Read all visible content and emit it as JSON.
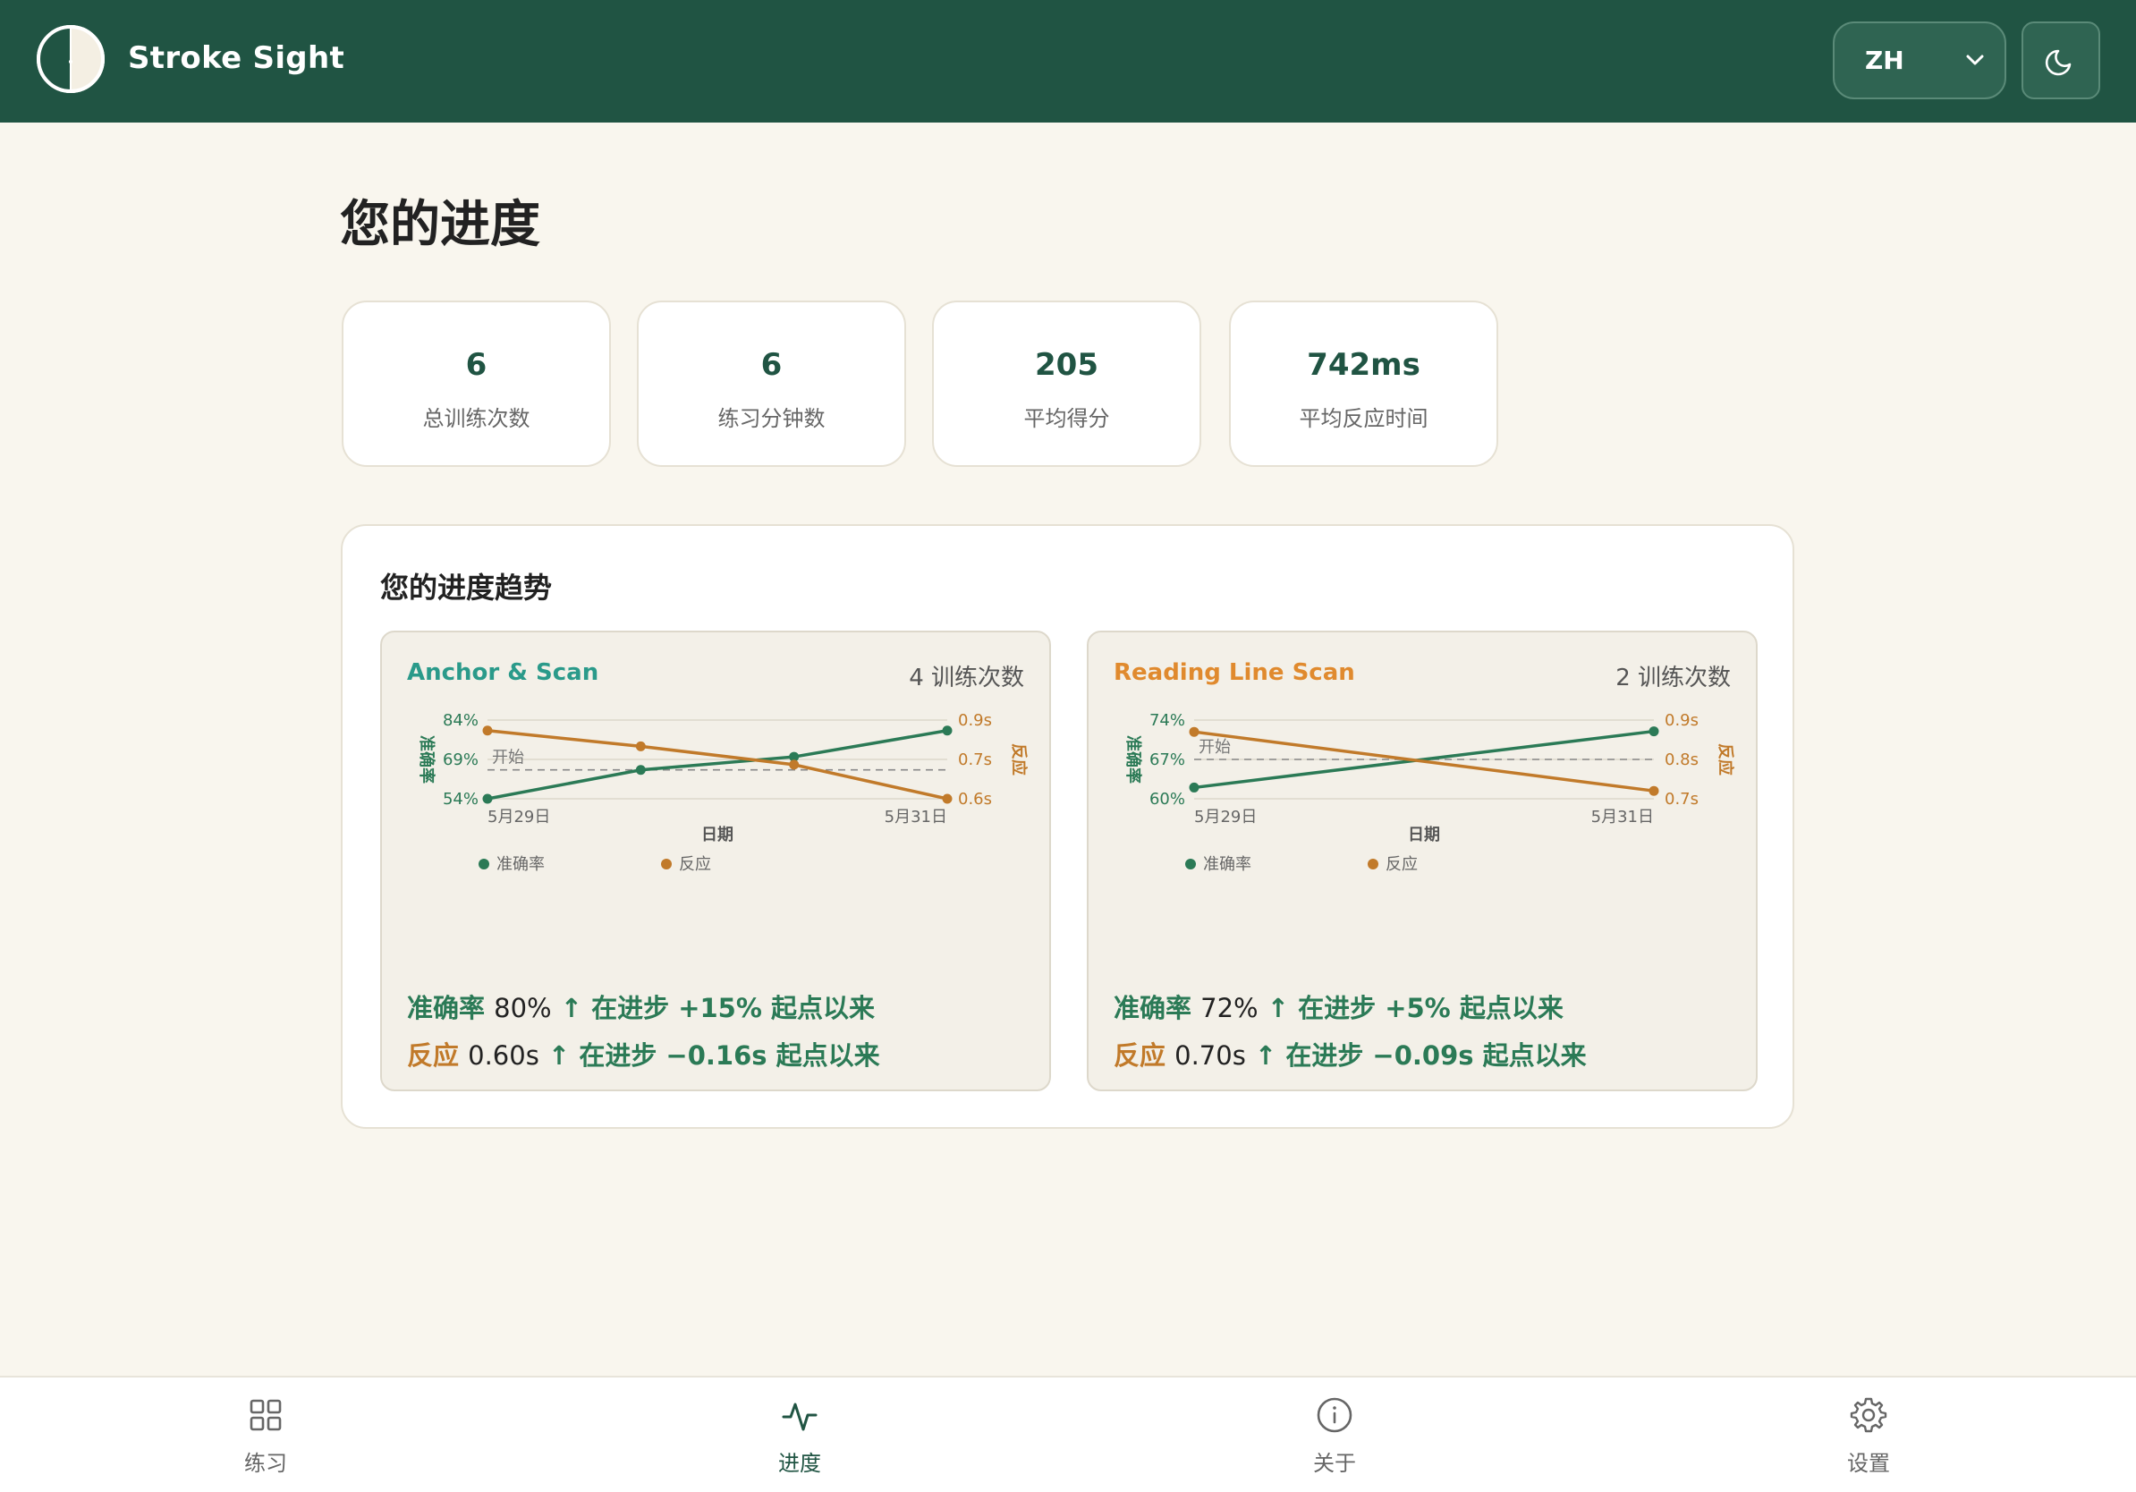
{
  "header": {
    "app_title": "Stroke Sight",
    "language": "ZH",
    "colors": {
      "header_bg": "#205443",
      "accent": "#205443"
    }
  },
  "page_title": "您的进度",
  "stats": [
    {
      "value": "6",
      "label": "总训练次数"
    },
    {
      "value": "6",
      "label": "练习分钟数"
    },
    {
      "value": "205",
      "label": "平均得分"
    },
    {
      "value": "742ms",
      "label": "平均反应时间"
    }
  ],
  "trends": {
    "title": "您的进度趋势",
    "exercises": [
      {
        "name": "Anchor & Scan",
        "name_color": "#2a9a8a",
        "sessions": "4 训练次数",
        "summary_accuracy": {
          "label": "准确率",
          "value": "80%",
          "trend": "↑ 在进步 +15% 起点以来"
        },
        "summary_reaction": {
          "label": "反应",
          "value": "0.60s",
          "trend": "↑ 在进步 −0.16s 起点以来"
        }
      },
      {
        "name": "Reading Line Scan",
        "name_color": "#e08a2e",
        "sessions": "2 训练次数",
        "summary_accuracy": {
          "label": "准确率",
          "value": "72%",
          "trend": "↑ 在进步 +5% 起点以来"
        },
        "summary_reaction": {
          "label": "反应",
          "value": "0.70s",
          "trend": "↑ 在进步 −0.09s 起点以来"
        }
      }
    ]
  },
  "chart_data": [
    {
      "type": "line",
      "title": "Anchor & Scan",
      "xlabel": "日期",
      "ylabel_left": "准确率",
      "ylabel_right": "反应",
      "x_tick_labels": [
        "5月29日",
        "5月31日"
      ],
      "y_left_ticks": [
        "84%",
        "69%",
        "54%"
      ],
      "y_right_ticks": [
        "0.9s",
        "0.7s",
        "0.6s"
      ],
      "y_left_range": [
        54,
        84
      ],
      "y_right_range": [
        0.6,
        0.9
      ],
      "baseline_label": "开始",
      "baseline_left_value": 65,
      "series": [
        {
          "name": "准确率",
          "axis": "left",
          "color": "#2b7a56",
          "values": [
            54,
            65,
            70,
            80
          ]
        },
        {
          "name": "反应",
          "axis": "right",
          "color": "#c17a2a",
          "values": [
            0.86,
            0.8,
            0.73,
            0.6
          ]
        }
      ],
      "legend": [
        "准确率",
        "反应"
      ],
      "legend_position": "bottom"
    },
    {
      "type": "line",
      "title": "Reading Line Scan",
      "xlabel": "日期",
      "ylabel_left": "准确率",
      "ylabel_right": "反应",
      "x_tick_labels": [
        "5月29日",
        "5月31日"
      ],
      "y_left_ticks": [
        "74%",
        "67%",
        "60%"
      ],
      "y_right_ticks": [
        "0.9s",
        "0.8s",
        "0.7s"
      ],
      "y_left_range": [
        60,
        74
      ],
      "y_right_range": [
        0.7,
        0.9
      ],
      "baseline_label": "开始",
      "baseline_left_value": 67,
      "series": [
        {
          "name": "准确率",
          "axis": "left",
          "color": "#2b7a56",
          "values": [
            62,
            72
          ]
        },
        {
          "name": "反应",
          "axis": "right",
          "color": "#c17a2a",
          "values": [
            0.87,
            0.72
          ]
        }
      ],
      "legend": [
        "准确率",
        "反应"
      ],
      "legend_position": "bottom"
    }
  ],
  "nav": [
    {
      "label": "练习",
      "icon": "grid-icon",
      "active": false
    },
    {
      "label": "进度",
      "icon": "activity-icon",
      "active": true
    },
    {
      "label": "关于",
      "icon": "info-icon",
      "active": false
    },
    {
      "label": "设置",
      "icon": "gear-icon",
      "active": false
    }
  ]
}
